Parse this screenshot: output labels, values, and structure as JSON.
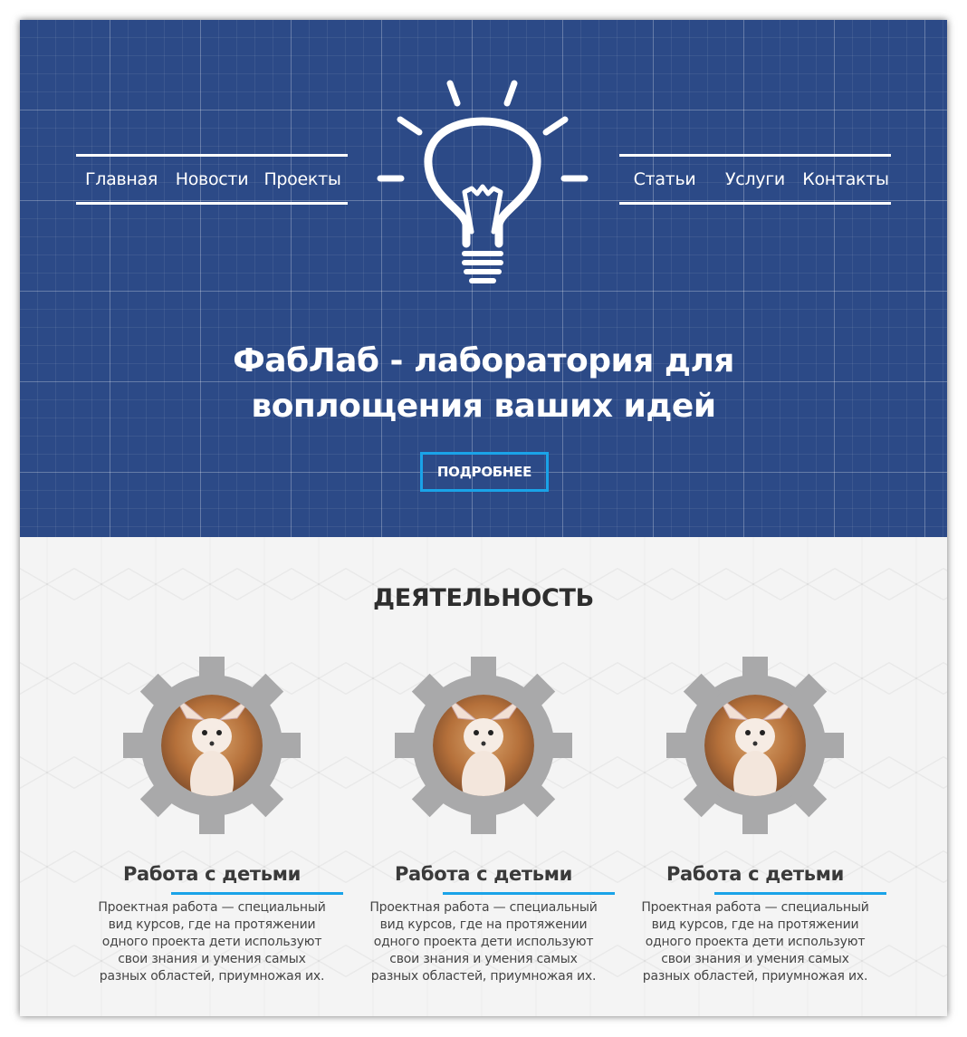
{
  "nav": {
    "left": [
      "Главная",
      "Новости",
      "Проекты"
    ],
    "right": [
      "Статьи",
      "Услуги",
      "Контакты"
    ]
  },
  "hero": {
    "logo_icon": "lightbulb-icon",
    "title_line1": "ФабЛаб - лаборатория для",
    "title_line2": "воплощения ваших идей",
    "button": "ПОДРОБНЕЕ"
  },
  "activities": {
    "title": "ДЕЯТЕЛЬНОСТЬ",
    "items": [
      {
        "title": "Работа с детьми",
        "text": [
          "Проектная работа — специальный",
          "вид курсов, где на протяжении",
          "одного проекта дети используют",
          "свои знания и умения самых",
          "разных областей, приумножая их."
        ],
        "image": "fennec-fox-in-gear"
      },
      {
        "title": "Работа с детьми",
        "text": [
          "Проектная работа — специальный",
          "вид курсов, где на протяжении",
          "одного проекта дети используют",
          "свои знания и умения самых",
          "разных областей, приумножая их."
        ],
        "image": "fennec-fox-in-gear"
      },
      {
        "title": "Работа с детьми",
        "text": [
          "Проектная работа — специальный",
          "вид курсов, где на протяжении",
          "одного проекта дети используют",
          "свои знания и умения самых",
          "разных областей, приумножая их."
        ],
        "image": "fennec-fox-in-gear"
      }
    ]
  },
  "colors": {
    "hero_bg": "#2c4a87",
    "accent": "#1aa3e8",
    "gear": "#a9a9aa"
  }
}
